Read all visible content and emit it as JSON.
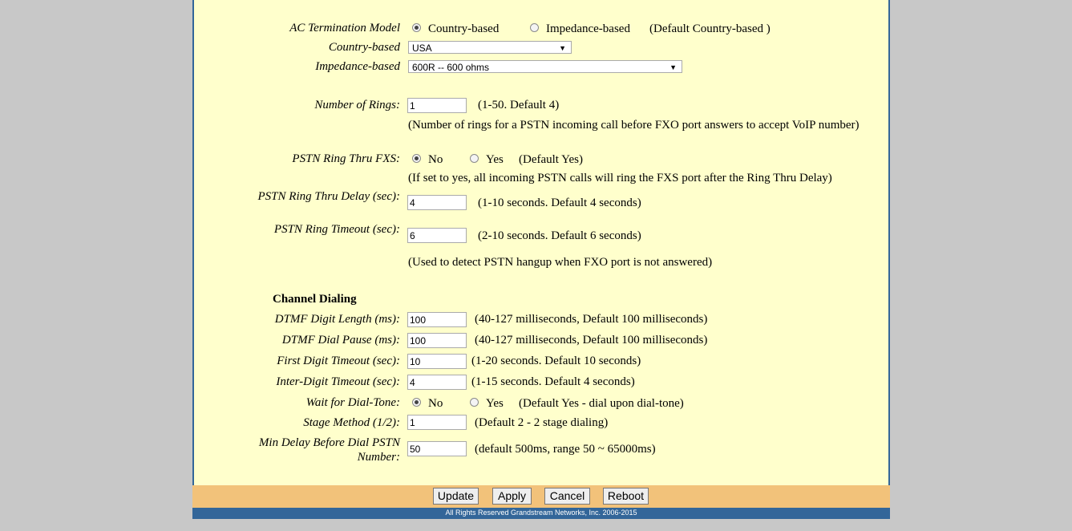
{
  "ac_termination": {
    "label": "AC Termination Model",
    "option_country": "Country-based",
    "option_impedance": "Impedance-based",
    "default_note": "(Default Country-based )",
    "selected": "country"
  },
  "country_based": {
    "label": "Country-based",
    "value": "USA"
  },
  "impedance_based": {
    "label": "Impedance-based",
    "value": "600R -- 600 ohms"
  },
  "number_of_rings": {
    "label": "Number of Rings:",
    "value": "1",
    "hint": "(1-50. Default 4)",
    "note": "(Number of rings for a PSTN incoming call before FXO port answers to accept VoIP number)"
  },
  "pstn_ring_thru_fxs": {
    "label": "PSTN Ring Thru FXS:",
    "option_no": "No",
    "option_yes": "Yes",
    "default_note": "(Default Yes)",
    "selected": "no",
    "note": "(If set to yes, all incoming PSTN calls will ring the FXS port after the Ring Thru Delay)"
  },
  "pstn_ring_thru_delay": {
    "label": "PSTN Ring Thru Delay (sec):",
    "value": "4",
    "hint": "(1-10 seconds. Default 4 seconds)"
  },
  "pstn_ring_timeout": {
    "label": "PSTN Ring Timeout (sec):",
    "value": "6",
    "hint": "(2-10 seconds. Default 6 seconds)",
    "note": "(Used to detect PSTN hangup when FXO port is not answered)"
  },
  "channel_dialing": {
    "heading": "Channel Dialing",
    "dtmf_digit_length": {
      "label": "DTMF Digit Length (ms):",
      "value": "100",
      "hint": "(40-127 milliseconds, Default 100 milliseconds)"
    },
    "dtmf_dial_pause": {
      "label": "DTMF Dial Pause (ms):",
      "value": "100",
      "hint": "(40-127 milliseconds, Default 100 milliseconds)"
    },
    "first_digit_timeout": {
      "label": "First Digit Timeout (sec):",
      "value": "10",
      "hint": "(1-20 seconds. Default 10 seconds)"
    },
    "inter_digit_timeout": {
      "label": "Inter-Digit Timeout (sec):",
      "value": "4",
      "hint": "(1-15 seconds. Default 4 seconds)"
    },
    "wait_for_dial_tone": {
      "label": "Wait for Dial-Tone:",
      "option_no": "No",
      "option_yes": "Yes",
      "default_note": "(Default Yes - dial upon dial-tone)",
      "selected": "no"
    },
    "stage_method": {
      "label": "Stage Method (1/2):",
      "value": "1",
      "hint": "(Default 2 - 2 stage dialing)"
    },
    "min_delay": {
      "label": "Min Delay Before Dial PSTN Number:",
      "value": "50",
      "hint": "(default 500ms, range 50 ~ 65000ms)"
    }
  },
  "buttons": {
    "update": "Update",
    "apply": "Apply",
    "cancel": "Cancel",
    "reboot": "Reboot"
  },
  "footer": "All Rights Reserved Grandstream Networks, Inc. 2006-2015",
  "colors": {
    "panel": "#ffffcc",
    "border": "#336699",
    "button_bar": "#f2c27a",
    "page_bg": "#c8c8c8"
  }
}
